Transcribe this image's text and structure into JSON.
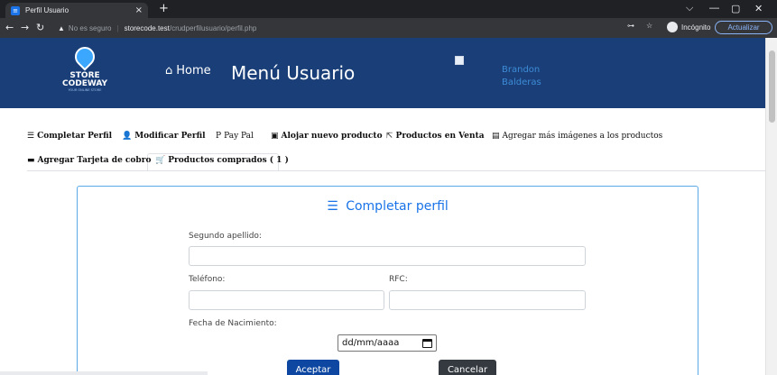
{
  "browser": {
    "tab_title": "Perfil Usuario",
    "tab_close": "×",
    "new_tab": "+",
    "url_warning": "No es seguro",
    "url_host": "storecode.test",
    "url_path": "/crudperfilusuario/perfil.php",
    "incognito": "Incógnito",
    "update_button": "Actualizar",
    "win_minimize": "—",
    "win_restore": "▢",
    "win_close": "✕",
    "win_menu": "⌵"
  },
  "header": {
    "logo_line1": "STORE",
    "logo_line2": "CODEWAY",
    "logo_line3": "YOUR ONLINE STORE",
    "home_label": "Home",
    "title": "Menú Usuario",
    "user_first": "Brandon",
    "user_last": "Balderas"
  },
  "nav": {
    "items": [
      {
        "label": "Completar Perfil",
        "icon": "list-check-icon"
      },
      {
        "label": "Modificar Perfil",
        "icon": "user-edit-icon"
      },
      {
        "label": "Pay Pal",
        "icon": "paypal-icon"
      },
      {
        "label": "Alojar nuevo producto",
        "icon": "image-upload-icon"
      },
      {
        "label": "Productos en Venta",
        "icon": "share-icon"
      },
      {
        "label": "Agregar más imágenes a los productos",
        "icon": "images-icon"
      },
      {
        "label": "Agregar Tarjeta de cobro",
        "icon": "credit-card-icon"
      },
      {
        "label": "Productos comprados ( 1 )",
        "icon": "cart-icon"
      }
    ]
  },
  "form": {
    "title": "Completar perfil",
    "second_surname_label": "Segundo apellido:",
    "second_surname_value": "",
    "phone_label": "Teléfono:",
    "phone_value": "",
    "rfc_label": "RFC:",
    "rfc_value": "",
    "birthdate_label": "Fecha de Nacimiento:",
    "birthdate_placeholder": "dd/mm/aaaa",
    "accept_label": "Aceptar",
    "cancel_label": "Cancelar"
  },
  "colors": {
    "banner": "#1a3f78",
    "accent": "#1a73e8",
    "primary_button": "#0d47a1",
    "dark_button": "#343a40"
  }
}
